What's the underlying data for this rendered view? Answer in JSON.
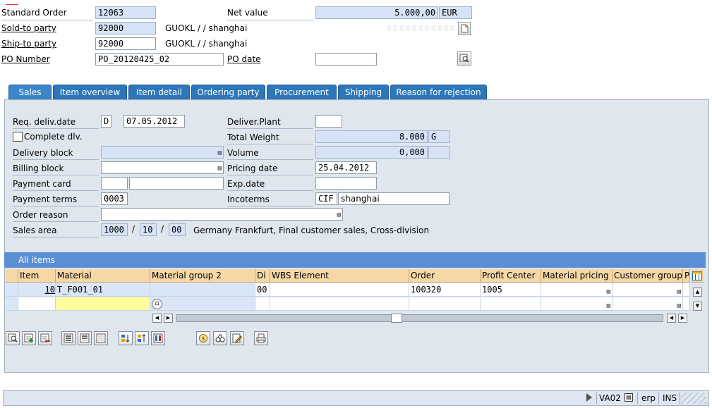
{
  "header": {
    "standard_order_label": "Standard Order",
    "standard_order_value": "12063",
    "net_value_label": "Net value",
    "net_value": "5.000,00",
    "currency": "EUR",
    "sold_to_label": "Sold-to party",
    "sold_to_value": "92000",
    "sold_to_name": "GUOKL / / shanghai",
    "ship_to_label": "Ship-to party",
    "ship_to_value": "92000",
    "ship_to_name": "GUOKL / / shanghai",
    "po_number_label": "PO Number",
    "po_number_value": "PO_20120425_02",
    "po_date_label": "PO date",
    "po_date_value": ""
  },
  "tabs": [
    {
      "label": "Sales",
      "active": true
    },
    {
      "label": "Item overview"
    },
    {
      "label": "Item detail"
    },
    {
      "label": "Ordering party"
    },
    {
      "label": "Procurement"
    },
    {
      "label": "Shipping"
    },
    {
      "label": "Reason for rejection"
    }
  ],
  "sales": {
    "req_deliv_label": "Req. deliv.date",
    "req_deliv_type": "D",
    "req_deliv_date": "07.05.2012",
    "complete_dlv_label": "Complete dlv.",
    "delivery_block_label": "Delivery block",
    "billing_block_label": "Billing block",
    "payment_card_label": "Payment card",
    "payment_terms_label": "Payment terms",
    "payment_terms_value": "0003",
    "order_reason_label": "Order reason",
    "sales_area_label": "Sales area",
    "sales_org": "1000",
    "distr_channel": "10",
    "division": "00",
    "sales_area_desc": "Germany Frankfurt, Final customer sales, Cross-division",
    "slash": "/",
    "deliver_plant_label": "Deliver.Plant",
    "total_weight_label": "Total Weight",
    "total_weight_value": "8.000",
    "weight_unit": "G",
    "volume_label": "Volume",
    "volume_value": "0,000",
    "pricing_date_label": "Pricing date",
    "pricing_date_value": "25.04.2012",
    "exp_date_label": "Exp.date",
    "incoterms_label": "Incoterms",
    "incoterms_code": "CIF",
    "incoterms_place": "shanghai"
  },
  "items": {
    "title": "All items",
    "columns": [
      "Item",
      "Material",
      "Material group 2",
      "Di",
      "WBS Element",
      "Order",
      "Profit Center",
      "Material pricing ...",
      "Customer group",
      "Pa"
    ],
    "rows": [
      {
        "item": "10",
        "material": "T_F001_01",
        "mg2": "",
        "di": "00",
        "wbs": "",
        "order": "100320",
        "profit_center": "1005",
        "mat_pricing": "",
        "cust_group": ""
      }
    ]
  },
  "status": {
    "transaction": "VA02",
    "system": "erp",
    "mode": "INS"
  }
}
